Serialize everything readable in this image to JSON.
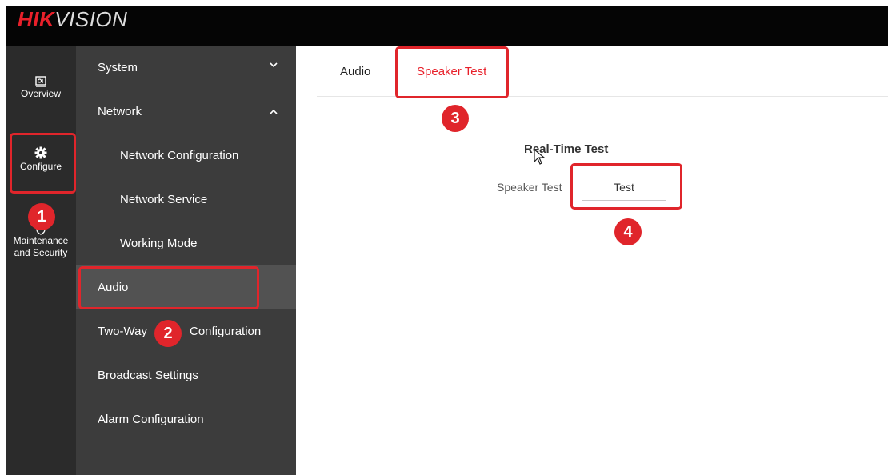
{
  "brand": {
    "logo_red": "HIK",
    "logo_rest": "VISION"
  },
  "icon_nav": [
    {
      "label": "Overview",
      "icon": "monitor-icon"
    },
    {
      "label": "Configure",
      "icon": "gear-icon"
    },
    {
      "label_line1": "Maintenance",
      "label_line2": "and Security",
      "icon": "shield-icon"
    }
  ],
  "sidebar": {
    "items": [
      {
        "label": "System",
        "level": "top",
        "chevron": "down"
      },
      {
        "label": "Network",
        "level": "top",
        "chevron": "up"
      },
      {
        "label": "Network Configuration",
        "level": "sub"
      },
      {
        "label": "Network Service",
        "level": "sub"
      },
      {
        "label": "Working Mode",
        "level": "sub"
      },
      {
        "label": "Audio",
        "level": "top",
        "active": true
      },
      {
        "label": "Two-Way Audio Configuration",
        "level": "top",
        "label_visible_left": "Two-Way",
        "label_visible_right": "Configuration"
      },
      {
        "label": "Broadcast Settings",
        "level": "top"
      },
      {
        "label": "Alarm Configuration",
        "level": "top"
      }
    ]
  },
  "tabs": [
    {
      "label": "Audio",
      "active": false
    },
    {
      "label": "Speaker Test",
      "active": true
    }
  ],
  "realtime": {
    "title": "Real-Time Test",
    "speaker_label": "Speaker Test",
    "test_button": "Test"
  },
  "annotations": {
    "step1": "1",
    "step2": "2",
    "step3": "3",
    "step4": "4"
  },
  "colors": {
    "accent": "#e8202a",
    "highlight": "#e0252b",
    "sidebar_bg": "#3c3c3c",
    "iconbar_bg": "#2b2b2b",
    "topbar_bg": "#050505"
  }
}
